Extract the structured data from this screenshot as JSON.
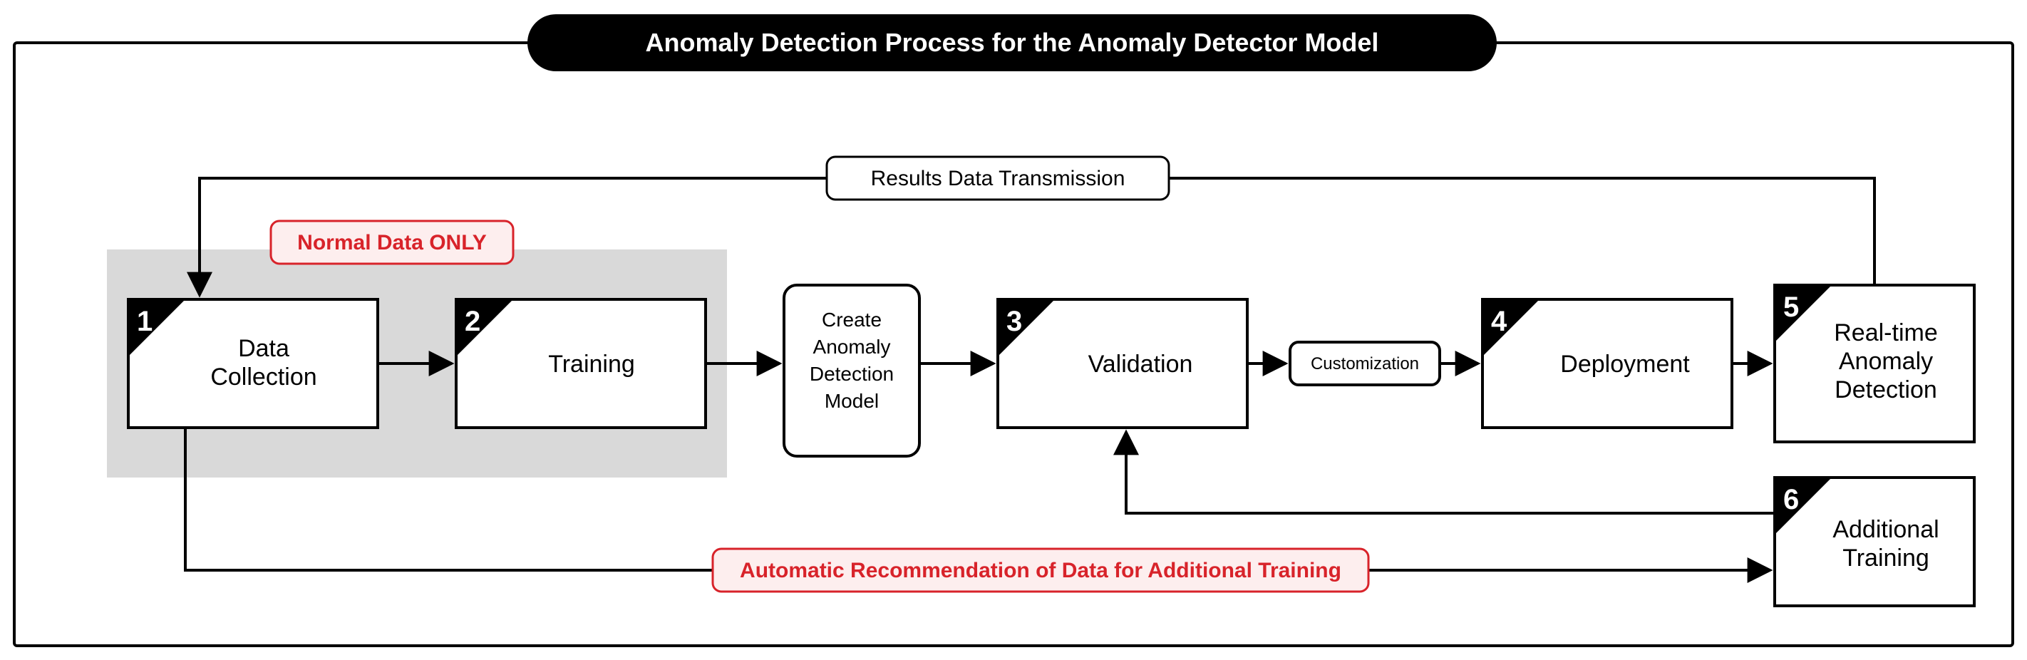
{
  "title": "Anomaly Detection Process for the Anomaly Detector Model",
  "normal_tag": "Normal Data ONLY",
  "steps": {
    "s1": {
      "num": "1",
      "label_1": "Data",
      "label_2": "Collection"
    },
    "s2": {
      "num": "2",
      "label_1": "Training",
      "label_2": ""
    },
    "s3": {
      "num": "3",
      "label_1": "Validation",
      "label_2": ""
    },
    "s4": {
      "num": "4",
      "label_1": "Deployment",
      "label_2": ""
    },
    "s5": {
      "num": "5",
      "label_1": "Real-time",
      "label_2": "Anomaly",
      "label_3": "Detection"
    },
    "s6": {
      "num": "6",
      "label_1": "Additional",
      "label_2": "Training"
    }
  },
  "nodes": {
    "create_model_1": "Create",
    "create_model_2": "Anomaly",
    "create_model_3": "Detection",
    "create_model_4": "Model",
    "customization": "Customization"
  },
  "edges": {
    "results": "Results Data Transmission",
    "recommend": "Automatic Recommendation of Data for Additional Training"
  }
}
